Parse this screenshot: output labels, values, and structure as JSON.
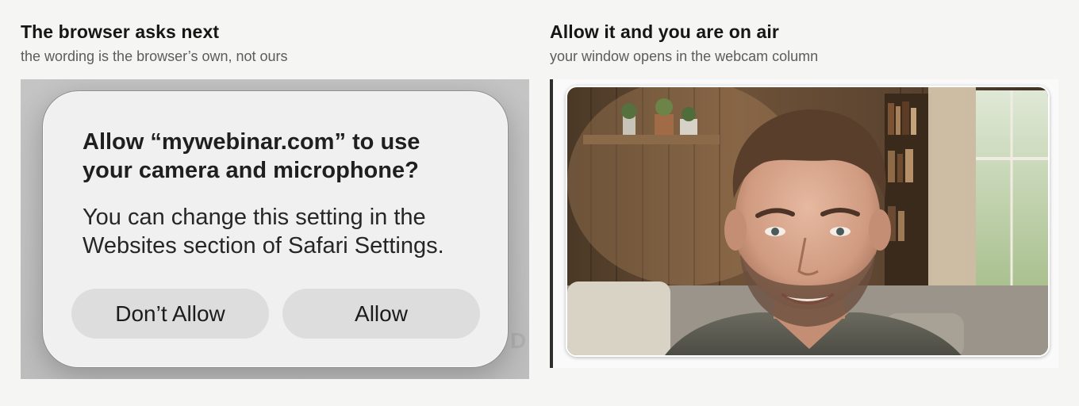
{
  "left_panel": {
    "title": "The browser asks next",
    "subtitle": "the wording is the browser’s own, not ours",
    "backdrop_letter": "D",
    "dialog": {
      "title": "Allow “mywebinar.com” to use your camera and microphone?",
      "body": "You can change this setting in the Websites section of Safari Settings.",
      "deny_label": "Don’t Allow",
      "allow_label": "Allow"
    }
  },
  "right_panel": {
    "title": "Allow it and you are on air",
    "subtitle": "your window opens in the webcam column",
    "webcam_feed": "smiling-man-webcam-image"
  }
}
